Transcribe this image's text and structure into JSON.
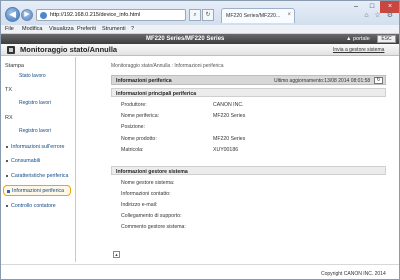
{
  "browser": {
    "back_label": "◀",
    "forward_label": "▶",
    "url": "http://192.168.0.215/device_info.html",
    "tab_title": "MF220 Series/MF220...",
    "tab_close": "×",
    "minimize": "–",
    "maximize": "□",
    "close": "×",
    "right_icons": "⌂ ☆ ⚙",
    "menu": [
      "File",
      "Modifica",
      "Visualizza",
      "Preferiti",
      "Strumenti",
      "?"
    ]
  },
  "banner": {
    "model": "MF220 Series/MF220 Series",
    "portal_link": "▲ portale",
    "lang_label": "ESC"
  },
  "page": {
    "title": "Monitoraggio stato/Annulla",
    "send_admin": "Invia a gestore sistema"
  },
  "sidebar": {
    "stampa_head": "Stampa",
    "stato_lavoro": "Stato lavoro",
    "tx_head": "TX",
    "registro_lavori_tx": "Registro lavori",
    "rx_head": "RX",
    "registro_lavori_rx": "Registro lavori",
    "items": [
      "Informazioni sull'errore",
      "Consumabili",
      "Caratteristiche periferica"
    ],
    "selected": "Informazioni periferica",
    "last": "Controllo contatore"
  },
  "main": {
    "breadcrumb": "Monitoraggio stato/Annulla : Informazioni periferica",
    "panel_title": "Informazioni periferica",
    "updated": "Ultimo aggiornamento:13/08 2014 08:01:58",
    "refresh": "↻",
    "section1_title": "Informazioni principali periferica",
    "section1_rows": [
      {
        "label": "Produttore:",
        "value": "CANON INC."
      },
      {
        "label": "Nome periferica:",
        "value": "MF220 Series"
      },
      {
        "label": "Posizione:",
        "value": ""
      },
      {
        "label": "Nome prodotto:",
        "value": "MF220 Series"
      },
      {
        "label": "Matricola:",
        "value": "XUY00186"
      }
    ],
    "section2_title": "Informazioni gestore sistema",
    "section2_rows": [
      {
        "label": "Nome gestore sistema:",
        "value": ""
      },
      {
        "label": "Informazioni contatto:",
        "value": ""
      },
      {
        "label": "Indirizzo e-mail:",
        "value": ""
      },
      {
        "label": "Collegamento di supporto:",
        "value": ""
      },
      {
        "label": "Commento gestore sistema:",
        "value": ""
      }
    ],
    "page_top": "▲"
  },
  "footer": {
    "copyright": "Copyright CANON INC. 2014"
  }
}
